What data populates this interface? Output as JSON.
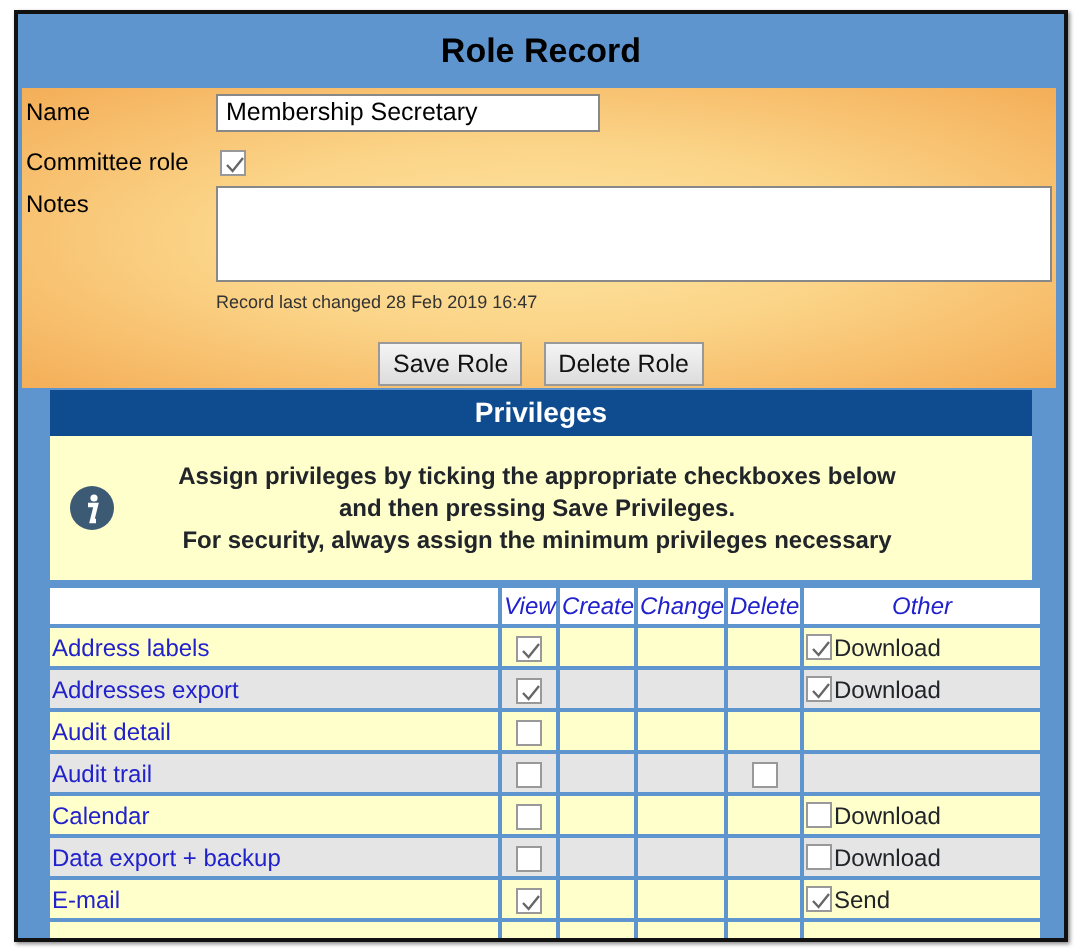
{
  "title": "Role Record",
  "form": {
    "name_label": "Name",
    "name_value": "Membership Secretary",
    "committee_label": "Committee role",
    "committee_checked": true,
    "notes_label": "Notes",
    "last_changed": "Record last changed 28 Feb 2019 16:47"
  },
  "buttons": [
    "Save Role",
    "Delete Role"
  ],
  "privileges": {
    "title": "Privileges",
    "info": [
      "Assign privileges by ticking the appropriate checkboxes below",
      "and then pressing Save Privileges.",
      "For security, always assign the minimum privileges necessary"
    ],
    "columns": [
      "View",
      "Create",
      "Change",
      "Delete",
      "Other"
    ],
    "rows": [
      {
        "name": "Address labels",
        "view": {
          "checked": true
        },
        "delete": null,
        "other": {
          "label": "Download",
          "checked": true
        }
      },
      {
        "name": "Addresses export",
        "view": {
          "checked": true
        },
        "delete": null,
        "other": {
          "label": "Download",
          "checked": true
        }
      },
      {
        "name": "Audit detail",
        "view": {
          "checked": false
        },
        "delete": null,
        "other": null
      },
      {
        "name": "Audit trail",
        "view": {
          "checked": false
        },
        "delete": {
          "checked": false
        },
        "other": null
      },
      {
        "name": "Calendar",
        "view": {
          "checked": false
        },
        "delete": null,
        "other": {
          "label": "Download",
          "checked": false
        }
      },
      {
        "name": "Data export + backup",
        "view": {
          "checked": false
        },
        "delete": null,
        "other": {
          "label": "Download",
          "checked": false
        }
      },
      {
        "name": "E-mail",
        "view": {
          "checked": true
        },
        "delete": null,
        "other": {
          "label": "Send",
          "checked": true
        }
      }
    ]
  }
}
